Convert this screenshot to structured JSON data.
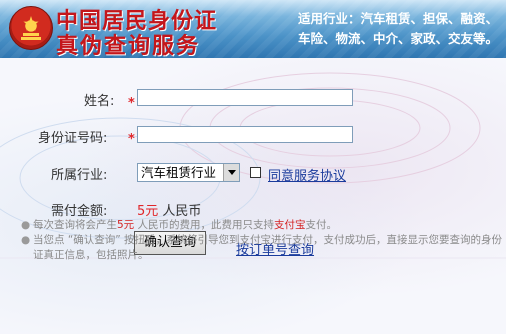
{
  "header": {
    "title_line1": "中国居民身份证",
    "title_line2": "真伪查询服务",
    "industries_line1": "适用行业：汽车租赁、担保、融资、",
    "industries_line2": "车险、物流、中介、家政、交友等。"
  },
  "form": {
    "name_label": "姓名:",
    "id_label": "身份证号码:",
    "industry_label": "所属行业:",
    "industry_selected": "汽车租赁行业",
    "agree_text": "同意服务协议",
    "agree_checked": false,
    "amount_label": "需付金额:",
    "amount_value": "5元",
    "amount_currency": "人民币",
    "required_mark": "*",
    "confirm_button": "确认查询",
    "order_lookup_link": "按订单号查询",
    "name_value": "",
    "id_value": ""
  },
  "notes": {
    "bullet": "●",
    "line1_part1": "每次查询将会产生",
    "line1_price": "5元",
    "line1_part2": " 人民币的费用，此费用只支持",
    "line1_alipay": "支付宝",
    "line1_part3": "支付。",
    "line2": "当您点 “确认查询” 按扭后，系统将引导您到支付宝进行支付，支付成功后，直接显示您要查询的身份证真正信息，包括照片。"
  },
  "colors": {
    "title_red": "#c4161b",
    "header_blue": "#3a82bd",
    "link_blue": "#1a3b9c",
    "required_red": "#e0262a"
  }
}
